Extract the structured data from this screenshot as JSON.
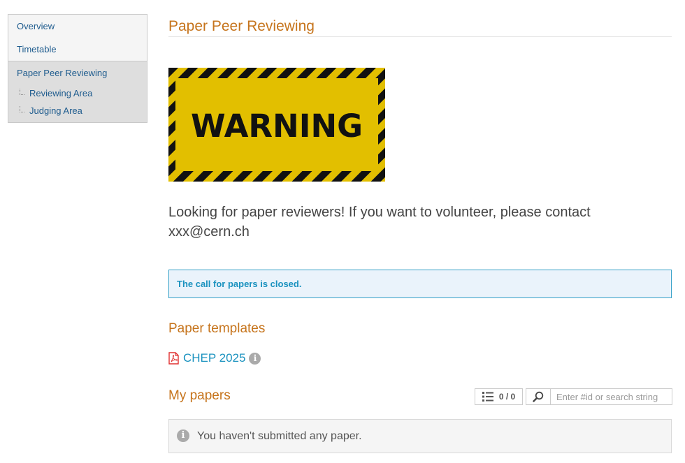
{
  "sidebar": {
    "items": [
      {
        "label": "Overview"
      },
      {
        "label": "Timetable"
      },
      {
        "label": "Paper Peer Reviewing"
      }
    ],
    "subitems": [
      {
        "label": "Reviewing Area"
      },
      {
        "label": "Judging Area"
      }
    ]
  },
  "page": {
    "title": "Paper Peer Reviewing",
    "warning_text": "WARNING",
    "lead": "Looking for paper reviewers! If you want to volunteer, please contact xxx@cern.ch",
    "alert": "The call for papers is closed."
  },
  "templates": {
    "title": "Paper templates",
    "items": [
      {
        "label": "CHEP 2025"
      }
    ]
  },
  "my_papers": {
    "title": "My papers",
    "counter": "0 / 0",
    "search_placeholder": "Enter #id or search string",
    "empty_message": "You haven't submitted any paper."
  },
  "colors": {
    "accent": "#c6741c",
    "link": "#1f5c8e",
    "info": "#1a92bf",
    "warning_yellow": "#e2bf00"
  }
}
